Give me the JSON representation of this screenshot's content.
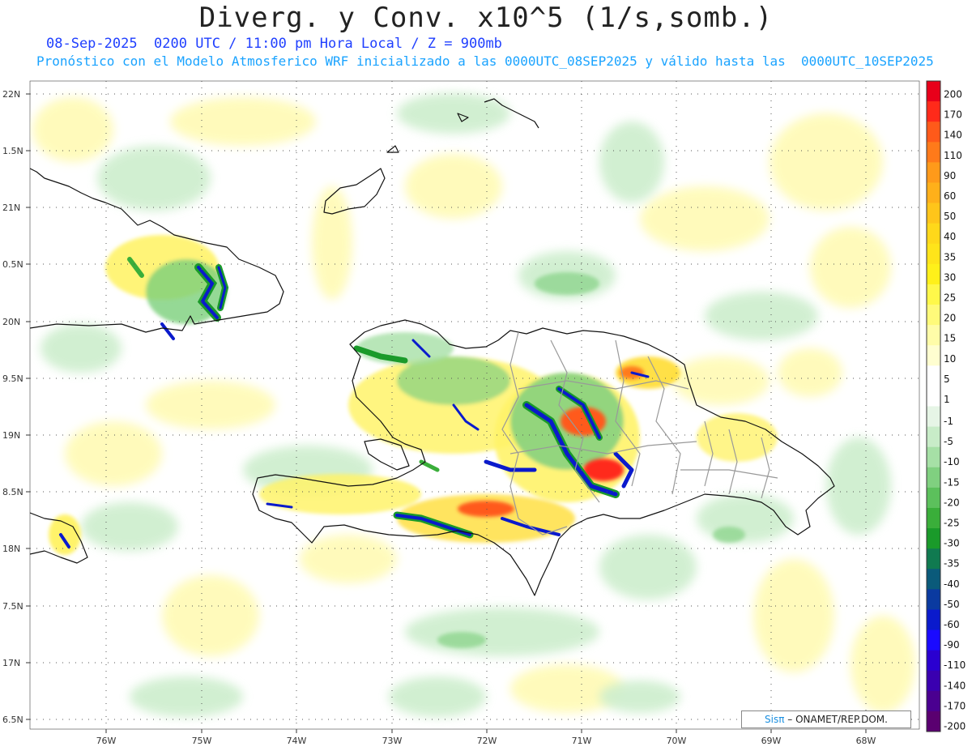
{
  "title": "Diverg. y Conv. x10^5 (1/s,somb.)",
  "subtitle_1": "08-Sep-2025  0200 UTC / 11:00 pm Hora Local / Z = 900mb",
  "subtitle_2": "Pronóstico con el Modelo Atmosferico WRF inicializado a las 0000UTC_08SEP2025 y válido hasta las  0000UTC_10SEP2025",
  "credit": {
    "logo": "Sisπ",
    "text": "– ONAMET/REP.DOM."
  },
  "lat_labels": [
    "22N",
    "1.5N",
    "21N",
    "0.5N",
    "20N",
    "9.5N",
    "19N",
    "8.5N",
    "18N",
    "7.5N",
    "17N",
    "6.5N"
  ],
  "lon_labels": [
    "76W",
    "75W",
    "74W",
    "73W",
    "72W",
    "71W",
    "70W",
    "69W",
    "68W"
  ],
  "colorbar": {
    "labels": [
      "200",
      "170",
      "140",
      "110",
      "90",
      "60",
      "50",
      "40",
      "35",
      "30",
      "25",
      "20",
      "15",
      "10",
      "5",
      "1",
      "-1",
      "-5",
      "-10",
      "-15",
      "-20",
      "-25",
      "-30",
      "-35",
      "-40",
      "-50",
      "-60",
      "-90",
      "-110",
      "-140",
      "-170",
      "-200"
    ],
    "colors": [
      "#e8001a",
      "#ff2a1a",
      "#ff5a1a",
      "#ff7a1a",
      "#ff9a1a",
      "#ffb01a",
      "#ffc51a",
      "#ffd81a",
      "#ffe41a",
      "#fff01a",
      "#fff84a",
      "#fffa7a",
      "#fffca8",
      "#fffed0",
      "#ffffff",
      "#ffffff",
      "#e6f5e6",
      "#c8ecc8",
      "#a6e0a6",
      "#80d080",
      "#5cc05c",
      "#3aae3a",
      "#1a9a2a",
      "#107a50",
      "#0a5a7a",
      "#0a3aa0",
      "#0a1acc",
      "#1a0aff",
      "#2a00d0",
      "#3a00b0",
      "#4a0090",
      "#5a0070"
    ]
  }
}
